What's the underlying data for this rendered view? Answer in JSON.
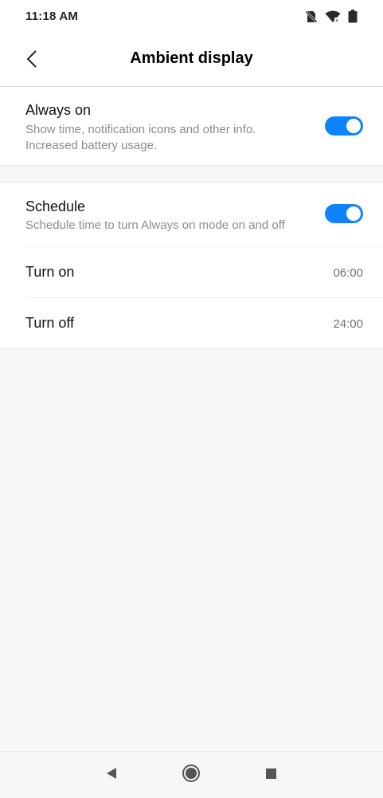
{
  "status_bar": {
    "time": "11:18 AM",
    "icons": [
      "no-sim-icon",
      "wifi-icon",
      "battery-icon"
    ]
  },
  "header": {
    "title": "Ambient display",
    "back_icon": "chevron-left-icon"
  },
  "always_on": {
    "title": "Always on",
    "subtitle": "Show time, notification icons and other info. Increased battery usage.",
    "enabled": true
  },
  "schedule": {
    "title": "Schedule",
    "subtitle": "Schedule time to turn Always on mode on and off",
    "enabled": true,
    "turn_on": {
      "label": "Turn on",
      "value": "06:00"
    },
    "turn_off": {
      "label": "Turn off",
      "value": "24:00"
    }
  },
  "nav_bar": {
    "icons": [
      "back-triangle-icon",
      "home-circle-icon",
      "recents-square-icon"
    ]
  },
  "colors": {
    "accent": "#0d84ff",
    "background": "#f7f7f7",
    "secondary_text": "#8c8c8c"
  }
}
